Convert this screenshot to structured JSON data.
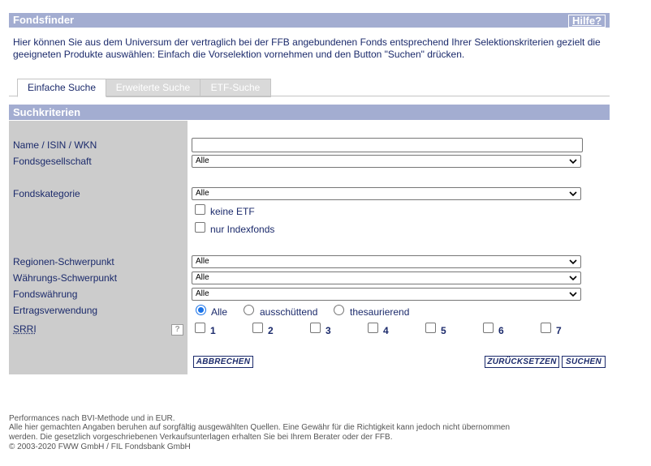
{
  "header": {
    "title": "Fondsfinder",
    "help_label": "Hilfe?"
  },
  "intro_line1": "Hier können Sie aus dem Universum der vertraglich bei der FFB angebundenen Fonds entsprechend Ihrer Selektionskriterien gezielt die",
  "intro_line2": "geeigneten Produkte auswählen: Einfach die Vorselektion vornehmen und den Button \"Suchen\" drücken.",
  "tabs": [
    {
      "label": "Einfache Suche",
      "active": true
    },
    {
      "label": "Erweiterte Suche",
      "active": false
    },
    {
      "label": "ETF-Suche",
      "active": false
    }
  ],
  "section_title": "Suchkriterien",
  "form": {
    "name_label": "Name / ISIN / WKN",
    "name_value": "",
    "gesellschaft_label": "Fondsgesellschaft",
    "gesellschaft_value": "Alle",
    "kategorie_label": "Fondskategorie",
    "kategorie_value": "Alle",
    "keine_etf_label": "keine ETF",
    "indexfonds_label": "nur Indexfonds",
    "regionen_label": "Regionen-Schwerpunkt",
    "regionen_value": "Alle",
    "waehrungs_label": "Währungs-Schwerpunkt",
    "waehrungs_value": "Alle",
    "fondswaehrung_label": "Fondswährung",
    "fondswaehrung_value": "Alle",
    "ertrag_label": "Ertragsverwendung",
    "ertrag_options": [
      "Alle",
      "ausschüttend",
      "thesaurierend"
    ],
    "ertrag_selected": "Alle",
    "srri_label": "SRRI",
    "srri_help": "?",
    "srri_options": [
      "1",
      "2",
      "3",
      "4",
      "5",
      "6",
      "7"
    ]
  },
  "buttons": {
    "abbrechen": "ABBRECHEN",
    "zuruecksetzen": "ZURÜCKSETZEN",
    "suchen": "SUCHEN"
  },
  "footer": {
    "line1": "Performances nach BVI-Methode und in EUR.",
    "line2": "Alle hier gemachten Angaben beruhen auf sorgfältig ausgewählten Quellen. Eine Gewähr für die Richtigkeit kann jedoch nicht übernommen",
    "line3": "werden. Die gesetzlich vorgeschriebenen Verkaufsunterlagen erhalten Sie bei Ihrem Berater oder der FFB.",
    "line4": "© 2003-2020 FWW GmbH / FIL Fondsbank GmbH"
  },
  "colors": {
    "header_bar": "#a3add1",
    "text": "#1b2a6b",
    "panel": "#cccccc"
  },
  "icons": {
    "select_arrow": "chevron-down-icon",
    "help": "help-icon"
  }
}
